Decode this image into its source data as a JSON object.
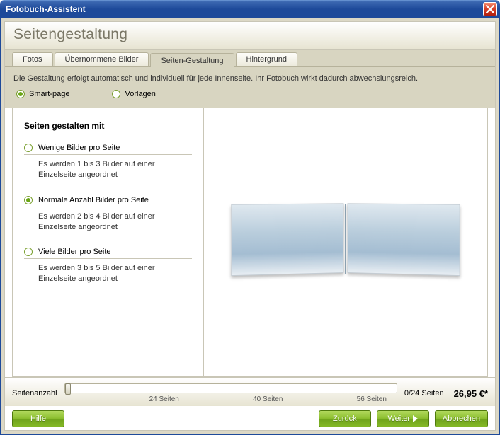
{
  "window": {
    "title": "Fotobuch-Assistent"
  },
  "header": {
    "title": "Seitengestaltung"
  },
  "tabs": {
    "items": [
      {
        "label": "Fotos"
      },
      {
        "label": "Übernommene Bilder"
      },
      {
        "label": "Seiten-Gestaltung"
      },
      {
        "label": "Hintergrund"
      }
    ],
    "activeIndex": 2
  },
  "hint": "Die Gestaltung erfolgt automatisch und individuell für jede Innenseite. Ihr Fotobuch wirkt dadurch abwechslungsreich.",
  "modes": {
    "items": [
      {
        "label": "Smart-page"
      },
      {
        "label": "Vorlagen"
      }
    ],
    "selectedIndex": 0
  },
  "options": {
    "title": "Seiten gestalten mit",
    "items": [
      {
        "label": "Wenige Bilder pro Seite",
        "desc": "Es werden 1 bis 3 Bilder auf einer Einzelseite angeordnet"
      },
      {
        "label": "Normale Anzahl Bilder pro Seite",
        "desc": "Es werden 2 bis 4 Bilder auf einer Einzelseite angeordnet"
      },
      {
        "label": "Viele Bilder pro Seite",
        "desc": "Es werden 3 bis 5 Bilder auf einer Einzelseite angeordnet"
      }
    ],
    "selectedIndex": 1
  },
  "status": {
    "label": "Seitenanzahl",
    "ticks": [
      "24 Seiten",
      "40 Seiten",
      "56 Seiten"
    ],
    "count": "0/24 Seiten",
    "price": "26,95 €*"
  },
  "buttons": {
    "help": "Hilfe",
    "back": "Zurück",
    "next": "Weiter",
    "cancel": "Abbrechen"
  }
}
